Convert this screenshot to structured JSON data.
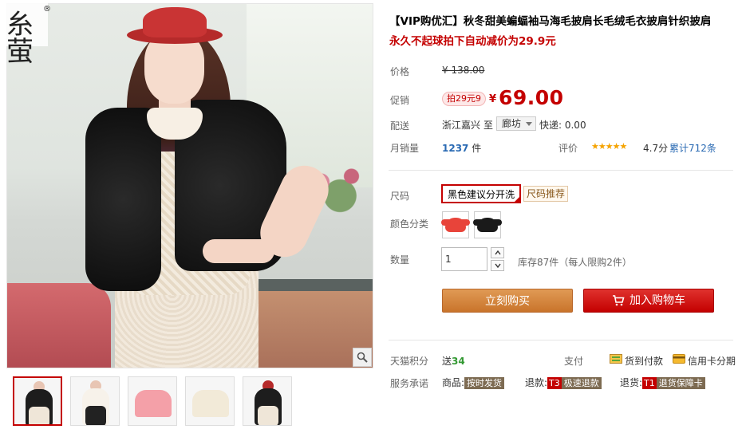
{
  "brand": {
    "logo_text": "糸萤",
    "registered_mark": "®"
  },
  "product": {
    "title": "【VIP购优汇】秋冬甜美蝙蝠袖马海毛披肩长毛绒毛衣披肩针织披肩",
    "subtitle": "永久不起球拍下自动减价为29.9元"
  },
  "price": {
    "label": "价格",
    "original": "¥ 138.00",
    "promo_label": "促销",
    "promo_badge": "拍29元9",
    "currency": "¥",
    "current": "69.00"
  },
  "delivery": {
    "label": "配送",
    "origin": "浙江嘉兴",
    "to": "至",
    "destination": "廊坊",
    "shipping": "快递: 0.00"
  },
  "sales": {
    "label": "月销量",
    "count": "1237",
    "unit": "件",
    "rating_label": "评价",
    "stars": "★★★★★",
    "score": "4.7分",
    "reviews": "累计712条"
  },
  "size": {
    "label": "尺码",
    "selected": "黑色建议分开洗",
    "recommend": "尺码推荐"
  },
  "color": {
    "label": "颜色分类",
    "options": [
      {
        "color": "#e8443a"
      },
      {
        "color": "#1a1a1a"
      }
    ]
  },
  "quantity": {
    "label": "数量",
    "value": "1",
    "stock": "库存87件",
    "limit": "（每人限购2件）"
  },
  "actions": {
    "buy_now": "立刻购买",
    "add_to_cart": "加入购物车"
  },
  "points": {
    "label": "天猫积分",
    "prefix": "送",
    "value": "34"
  },
  "payment": {
    "label": "支付",
    "cod": "货到付款",
    "installment": "信用卡分期"
  },
  "service": {
    "label": "服务承诺",
    "goods_label": "商品:",
    "goods_tag": "按时发货",
    "refund_label": "退款:",
    "refund_t": "T3",
    "refund_tag": "极速退款",
    "return_label": "退货:",
    "return_t": "T1",
    "return_tag": "退货保障卡"
  },
  "colors": {
    "accent": "#c40000",
    "buy_button": "#d9873e",
    "cart_button": "#d21a18",
    "link": "#2a6ab3"
  }
}
